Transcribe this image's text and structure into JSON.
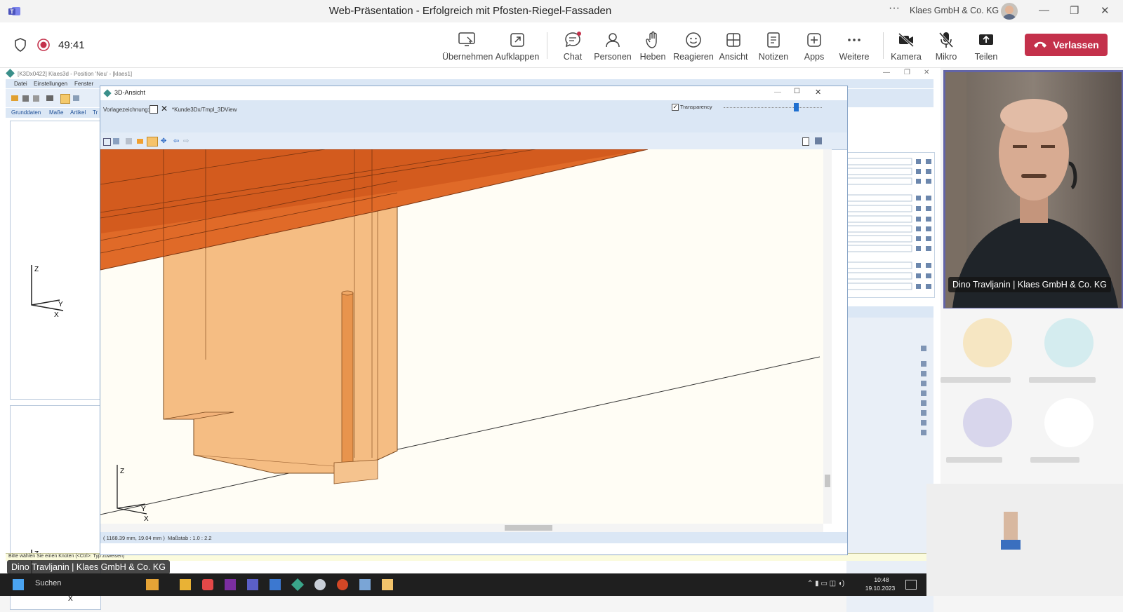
{
  "titlebar": {
    "title": "Web-Präsentation - Erfolgreich mit Pfosten-Riegel-Fassaden",
    "organization": "Klaes GmbH & Co. KG",
    "more": "···",
    "minimize": "—",
    "restore": "❐",
    "close": "✕"
  },
  "meeting": {
    "timer": "49:41",
    "buttons": [
      {
        "id": "uebernehmen",
        "label": "Übernehmen",
        "icon": "take-control-icon"
      },
      {
        "id": "aufklappen",
        "label": "Aufklappen",
        "icon": "pop-out-icon"
      },
      {
        "id": "chat",
        "label": "Chat",
        "icon": "chat-icon"
      },
      {
        "id": "personen",
        "label": "Personen",
        "icon": "people-icon"
      },
      {
        "id": "heben",
        "label": "Heben",
        "icon": "raise-hand-icon"
      },
      {
        "id": "reagieren",
        "label": "Reagieren",
        "icon": "smiley-icon"
      },
      {
        "id": "ansicht",
        "label": "Ansicht",
        "icon": "view-icon"
      },
      {
        "id": "notizen",
        "label": "Notizen",
        "icon": "notes-icon"
      },
      {
        "id": "apps",
        "label": "Apps",
        "icon": "apps-icon"
      },
      {
        "id": "weitere",
        "label": "Weitere",
        "icon": "more-icon"
      },
      {
        "id": "kamera",
        "label": "Kamera",
        "icon": "camera-off-icon"
      },
      {
        "id": "mikro",
        "label": "Mikro",
        "icon": "mic-off-icon"
      },
      {
        "id": "teilen",
        "label": "Teilen",
        "icon": "share-icon"
      }
    ],
    "leave_label": "Verlassen",
    "leave_color": "#c4314b"
  },
  "cad": {
    "app_title": "[K3Dx0422] Klaes3d - Position 'Neu' - [klaes1]",
    "menu": [
      "Datei",
      "Einstellungen",
      "Fenster"
    ],
    "tabs": [
      "Grunddaten",
      "Maße",
      "Artikel",
      "Tr"
    ],
    "status_hint": "Bitte wählen Sie einen Knoten (<Ctrl>: Typ zuweisen)",
    "axes": {
      "z": "Z",
      "y": "Y",
      "x": "X"
    }
  },
  "view3d": {
    "title": "3D-Ansicht",
    "template_label": "Vorlagezeichnung:",
    "template_path": "*Kunde3Dx/Tmpl_3DView",
    "transparency_label": "Transparency",
    "transparency_checked": true,
    "coords": "( 1168.39 mm, 19.04 mm )",
    "scale": "Maßstab : 1.0 : 2.2"
  },
  "participants": {
    "presenter_name": "Dino Travljanin | Klaes GmbH & Co. KG",
    "share_overlay_name": "Dino Travljanin | Klaes GmbH & Co. KG"
  },
  "taskbar": {
    "search": "Suchen",
    "time": "10:48",
    "date": "19.10.2023"
  },
  "colors": {
    "teams_purple": "#6264a7",
    "orange_dark": "#e06a28",
    "orange_light": "#f5bd83",
    "canvas_bg": "#fffdf5"
  }
}
